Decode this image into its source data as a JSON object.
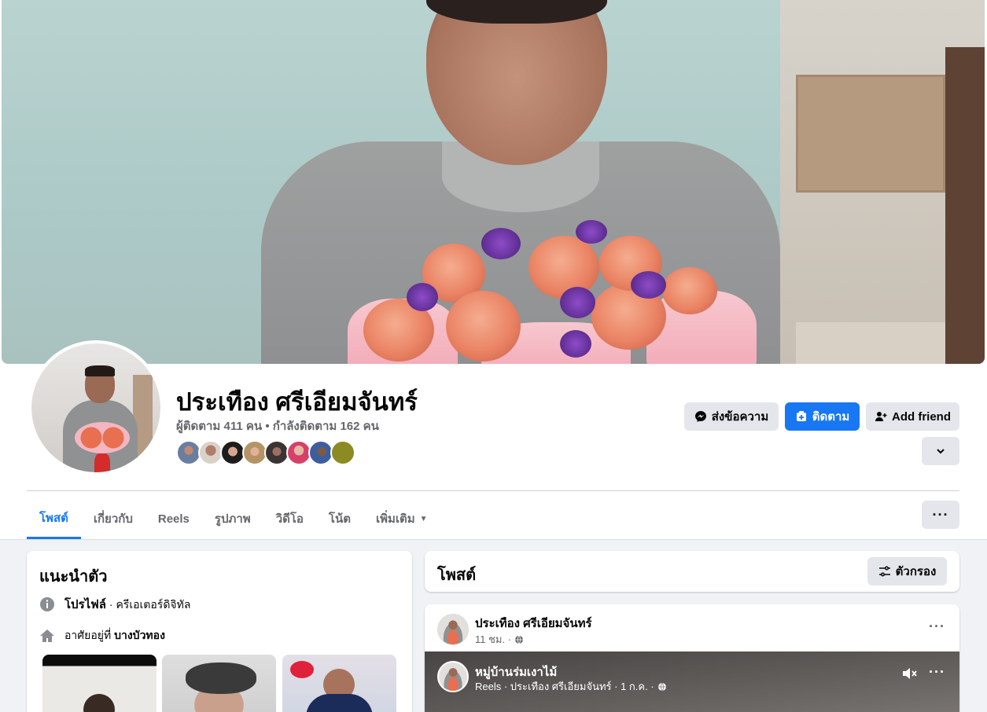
{
  "profile": {
    "name": "ประเทือง ศรีเอียมจันทร์",
    "followers_text": "ผู้ติดตาม 411 คน • กำลังติดตาม 162 คน"
  },
  "actions": {
    "message_label": "ส่งข้อความ",
    "follow_label": "ติดตาม",
    "add_friend_label": "Add friend"
  },
  "tabs": [
    {
      "label": "โพสต์",
      "active": true
    },
    {
      "label": "เกี่ยวกับ"
    },
    {
      "label": "Reels"
    },
    {
      "label": "รูปภาพ"
    },
    {
      "label": "วิดีโอ"
    },
    {
      "label": "โน้ต"
    },
    {
      "label": "เพิ่มเติม"
    }
  ],
  "intro": {
    "title": "แนะนำตัว",
    "profile_label": "โปรไฟล์",
    "profile_value": " · ครีเอเตอร์ดิจิทัล",
    "lives_prefix": "อาศัยอยู่ที่ ",
    "lives_value": "บางบัวทอง"
  },
  "posts_header": {
    "title": "โพสต์",
    "filter_label": "ตัวกรอง"
  },
  "post": {
    "author": "ประเทือง ศรีเอียมจันทร์",
    "time": "11 ชม. ·",
    "reel_title": "หมู่บ้านร่มเงาไม้",
    "reel_sub": "Reels · ประเทือง ศรีเอียมจันทร์ · 1 ก.ค. ·"
  },
  "colors": {
    "accent": "#1877f2",
    "gray_button": "#e4e6eb",
    "secondary_text": "#65676b",
    "feed_background": "#f0f2f5"
  },
  "icons": [
    "messenger-icon",
    "follow-icon",
    "add-friend-icon",
    "chevron-down-icon",
    "more-icon",
    "info-icon",
    "home-icon",
    "filter-icon",
    "globe-icon",
    "mute-icon"
  ]
}
